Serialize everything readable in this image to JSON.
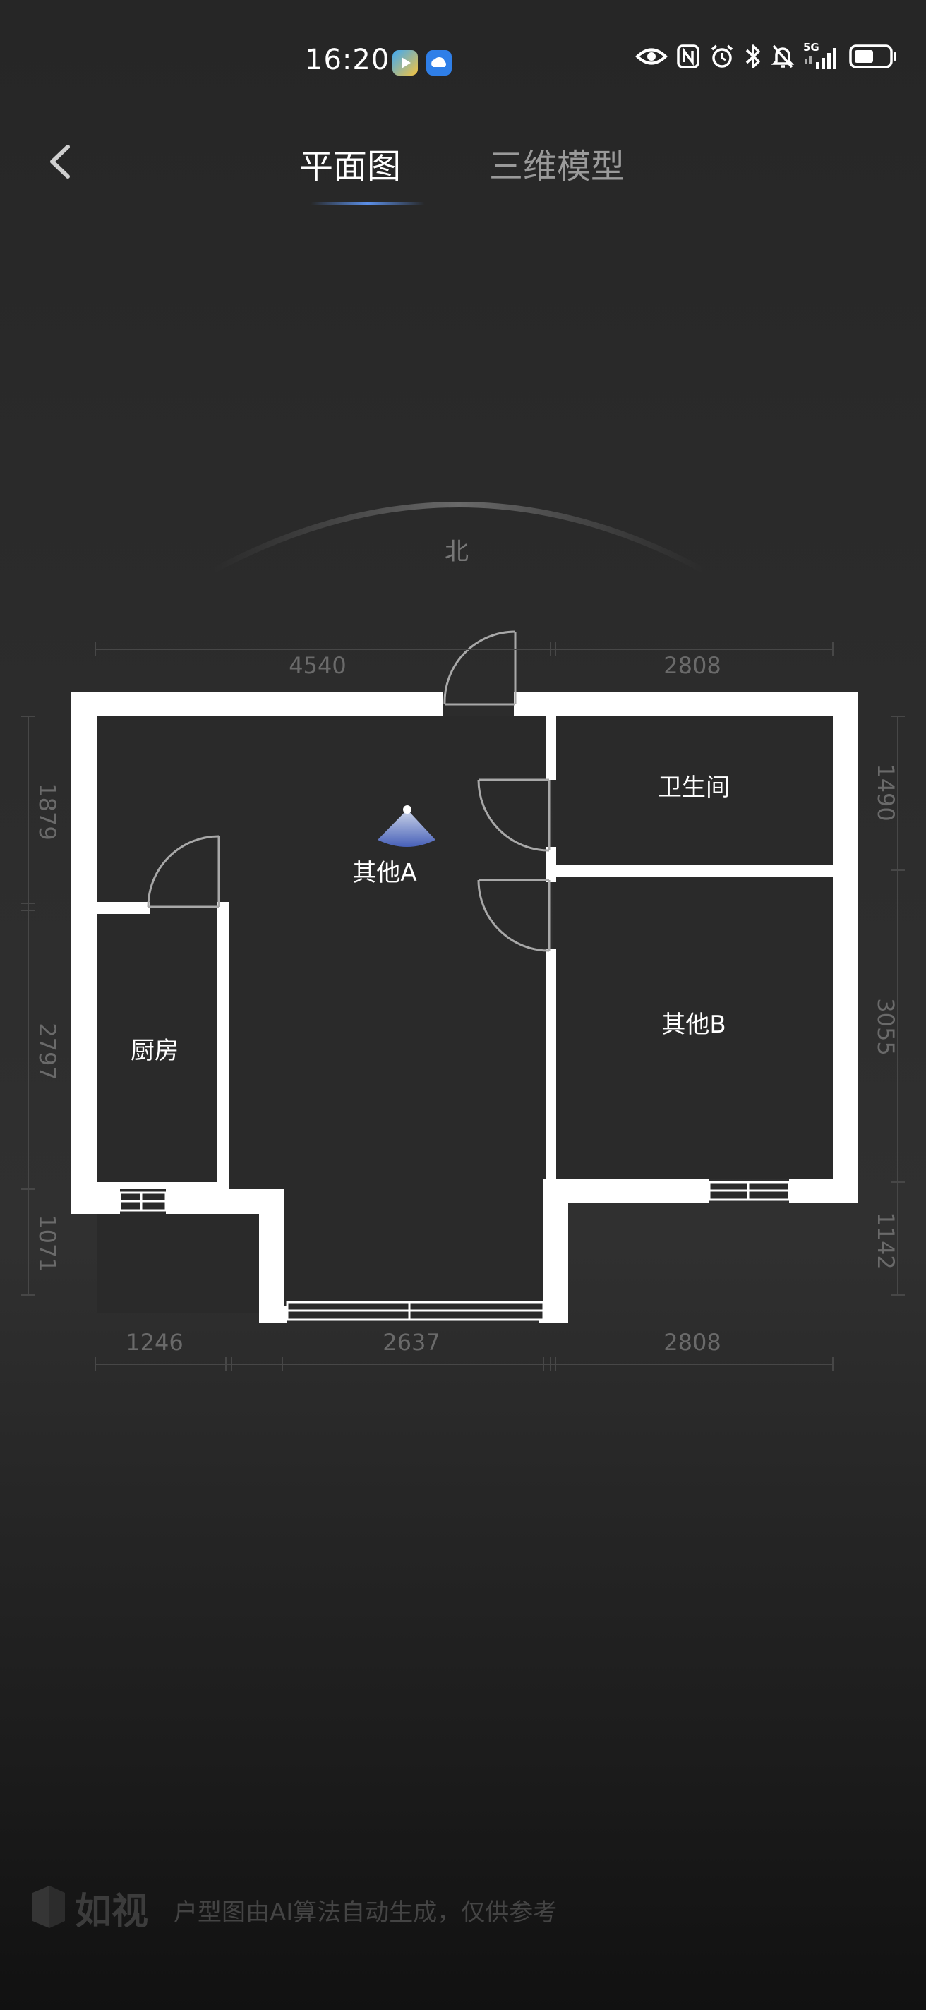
{
  "status_bar": {
    "time": "16:20",
    "network": "5G",
    "icons": [
      "eye-icon",
      "nfc-icon",
      "alarm-icon",
      "bluetooth-icon",
      "mute-icon",
      "signal-icon",
      "battery-icon"
    ]
  },
  "nav": {
    "tabs": [
      {
        "label": "平面图",
        "active": true
      },
      {
        "label": "三维模型",
        "active": false
      }
    ],
    "accent_color": "#5b8fe8"
  },
  "floor_plan": {
    "compass_label": "北",
    "rooms": {
      "main": "其他A",
      "bathroom": "卫生间",
      "room_b": "其他B",
      "kitchen": "厨房"
    },
    "dimensions": {
      "top": [
        "4540",
        "2808"
      ],
      "bottom": [
        "1246",
        "2637",
        "2808"
      ],
      "left": [
        "1879",
        "2797",
        "1071"
      ],
      "right": [
        "1490",
        "3055",
        "1142"
      ]
    }
  },
  "footer": {
    "brand": "如视",
    "disclaimer": "户型图由AI算法自动生成，仅供参考"
  }
}
